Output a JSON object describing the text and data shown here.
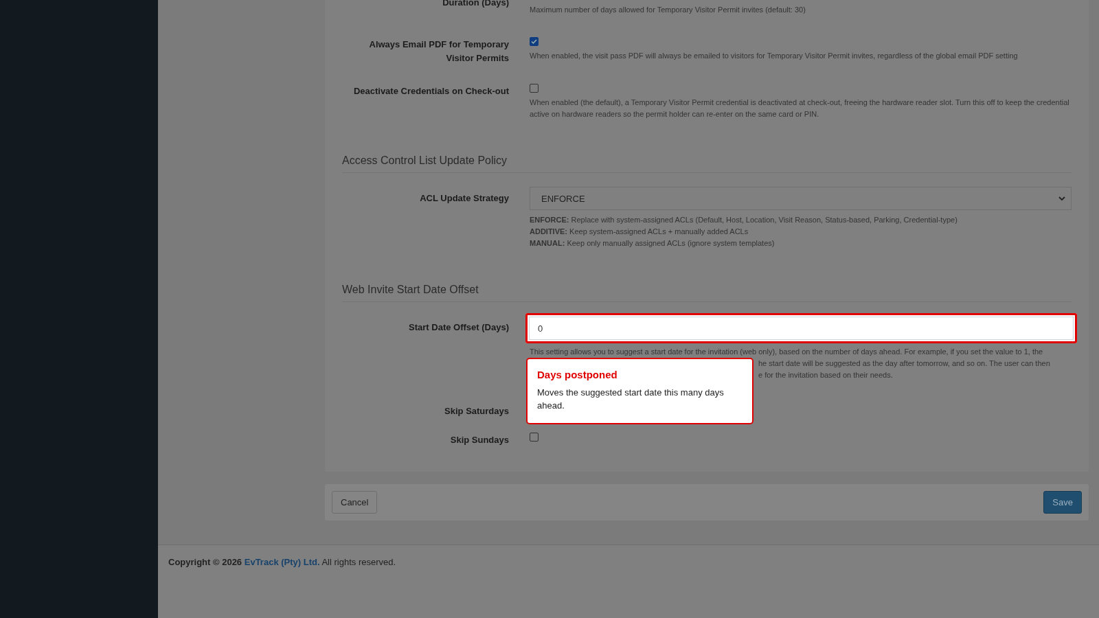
{
  "settings": [
    {
      "kind": "text",
      "label": "Duration (Days)",
      "help": "Maximum number of days allowed for Temporary Visitor Permit invites (default: 30)"
    },
    {
      "kind": "checkbox",
      "label": "Always Email PDF for Temporary Visitor Permits",
      "checked": true,
      "help": "When enabled, the visit pass PDF will always be emailed to visitors for Temporary Visitor Permit invites, regardless of the global email PDF setting"
    },
    {
      "kind": "checkbox",
      "label": "Deactivate Credentials on Check-out",
      "checked": false,
      "help": "When enabled (the default), a Temporary Visitor Permit credential is deactivated at check-out, freeing the hardware reader slot. Turn this off to keep the credential active on hardware readers so the permit holder can re-enter on the same card or PIN."
    }
  ],
  "sections": [
    {
      "title": "Access Control List Update Policy",
      "rows": [
        {
          "kind": "select",
          "label": "ACL Update Strategy",
          "value": "ENFORCE",
          "help_lines": [
            {
              "text": "**ENFORCE:** Replace with system-assigned ACLs (Default, Host, Location, Visit Reason, Status-based, Parking, Credential-type)"
            },
            {
              "text": "**ADDITIVE:** Keep system-assigned ACLs + manually added ACLs"
            },
            {
              "text": "**MANUAL:** Keep only manually assigned ACLs (ignore system templates)"
            }
          ]
        }
      ]
    },
    {
      "title": "Web Invite Start Date Offset",
      "rows": [
        {
          "kind": "number",
          "label": "Start Date Offset (Days)",
          "value": "0",
          "highlighted": true,
          "help_lines": [
            {
              "text": "This setting allows you to suggest a start date for the invitation (web only), based on the number of days ahead. For example, if you set the value to 1, the",
              "covered": false
            },
            {
              "text": "he start date will be suggested as the day after tomorrow, and so on. The user can then",
              "covered": true
            },
            {
              "text": "e for the invitation based on their needs.",
              "covered": true
            }
          ]
        },
        {
          "kind": "text",
          "label": "Skip Saturdays"
        },
        {
          "kind": "checkbox",
          "label": "Skip Sundays",
          "checked": false
        }
      ]
    }
  ],
  "tooltip": {
    "title": "Days postponed",
    "body": "Moves the suggested start date this many days ahead."
  },
  "actions": [
    {
      "label": "Cancel",
      "kind": "secondary"
    },
    {
      "label": "Save",
      "kind": "primary"
    }
  ],
  "footer": {
    "prefix": "Copyright © 2026",
    "link": "EvTrack (Pty) Ltd.",
    "suffix": "All rights reserved."
  }
}
